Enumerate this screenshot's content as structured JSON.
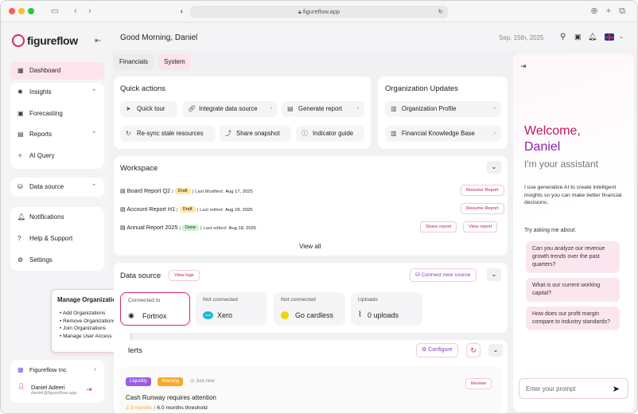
{
  "browser": {
    "url": "figureflow.app"
  },
  "colors": {
    "accent": "#e0245e",
    "nav_active": "#fde4ec",
    "draft": "#ffe7a3",
    "done": "#c9f2d3",
    "liquidity": "#9b5de5",
    "warning": "#f9a826"
  },
  "sidebar": {
    "logo": "figureflow",
    "items": [
      {
        "label": "Dashboard",
        "icon": "grid-icon"
      },
      {
        "label": "Insights",
        "icon": "bulb-icon"
      },
      {
        "label": "Forecasting",
        "icon": "calendar-icon"
      },
      {
        "label": "Reports",
        "icon": "report-icon"
      },
      {
        "label": "AI Query",
        "icon": "sparkle-icon"
      },
      {
        "label": "Data source",
        "icon": "database-icon"
      },
      {
        "label": "Notifications",
        "icon": "bell-icon"
      },
      {
        "label": "Help & Support",
        "icon": "help-icon"
      },
      {
        "label": "Settings",
        "icon": "gear-icon"
      }
    ],
    "org": "Figureflow Inc",
    "user": {
      "name": "Daniel Adeeri",
      "email": "daniel@figureflow.app"
    }
  },
  "tooltip": {
    "title": "Manage Organizations",
    "items": [
      "Add Organizations",
      "Remove Organizations",
      "Join Organizations",
      "Manage User Access"
    ]
  },
  "header": {
    "greeting": "Good Morning, Daniel",
    "date": "Sep. 15th, 2025"
  },
  "tabs": [
    "Financials",
    "System"
  ],
  "quick_actions": {
    "title": "Quick actions",
    "items": [
      "Quick tour",
      "Integrate data source",
      "Generate report",
      "Re-sync stale resources",
      "Share snapshot",
      "Indicator guide"
    ]
  },
  "org_updates": {
    "title": "Organization Updates",
    "items": [
      "Organization Profile",
      "Financial Knowledge Base"
    ]
  },
  "workspace": {
    "title": "Workspace",
    "docs": [
      {
        "name": "Board Report Q2",
        "status": "Draft",
        "date_label": "Last Modified:",
        "date": "Aug 17, 2025",
        "actions": [
          "Resume Report"
        ]
      },
      {
        "name": "Account Report H1",
        "status": "Draft",
        "date_label": "Last edited:",
        "date": "Aug 18, 2025",
        "actions": [
          "Resume Report"
        ]
      },
      {
        "name": "Annual Report 2025",
        "status": "Done",
        "date_label": "Last edited:",
        "date": "Aug 18, 2025",
        "actions": [
          "Share report",
          "View report"
        ]
      }
    ],
    "view_all": "View all"
  },
  "data_source": {
    "title": "Data source",
    "view_logs": "View logs",
    "connect": "Connect new source",
    "cards": [
      {
        "label": "Connected to",
        "value": "Fortnox"
      },
      {
        "label": "Not connected",
        "value": "Xero"
      },
      {
        "label": "Not connected",
        "value": "Go cardless"
      },
      {
        "label": "Uploads",
        "value": "0 uploads"
      }
    ]
  },
  "alerts": {
    "title": "lerts",
    "configure": "Configure",
    "item": {
      "tags": [
        "Liquidity",
        "Warning"
      ],
      "time": "Just now",
      "title": "Cash Runway requires attention",
      "value": "2.3 months",
      "threshold": "6.0 months threshold",
      "action": "Review"
    }
  },
  "assistant": {
    "welcome1": "Welcome,",
    "welcome2": "Daniel",
    "sub": "I'm your assistant",
    "desc": "I use generative AI to create intelligent insights so you can make better financial decisions.",
    "try": "Try asking me about:",
    "suggestions": [
      "Can you analyze our revenue growth trends over the past quarters?",
      "What is our current working capital?",
      "How does our profit margin compare to industry standards?"
    ],
    "prompt_placeholder": "Enter your prompt"
  }
}
